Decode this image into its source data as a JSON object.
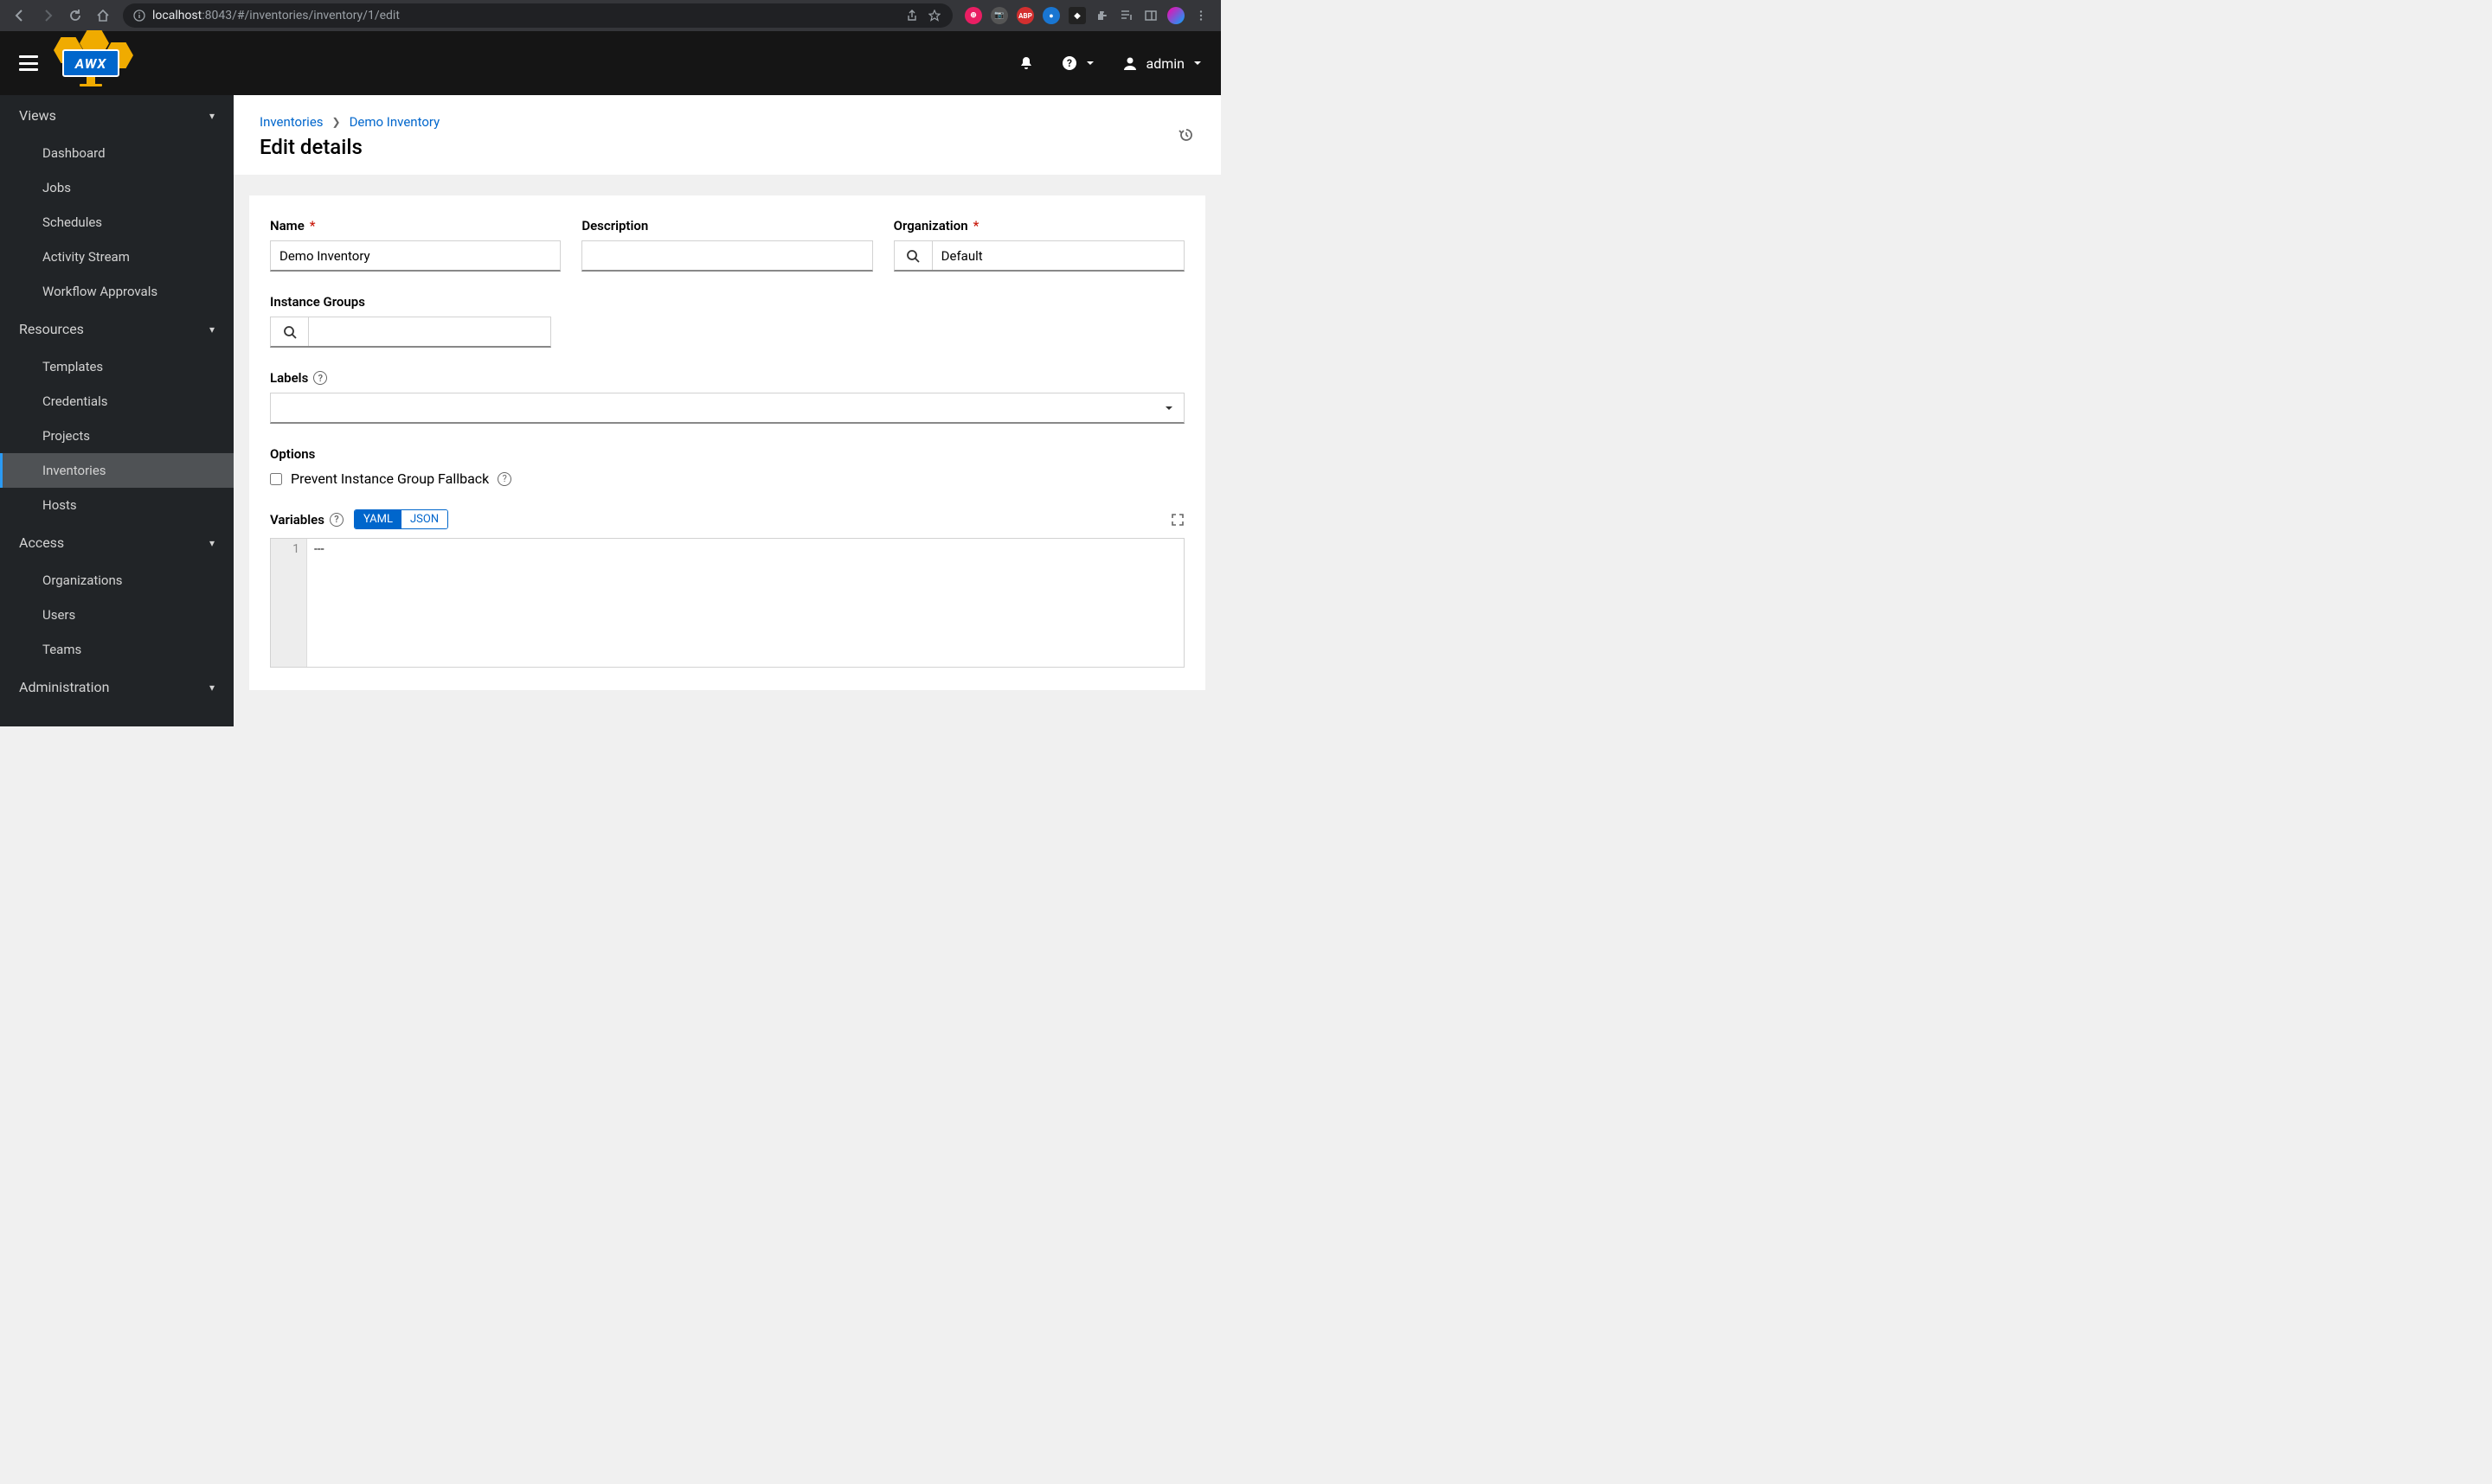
{
  "browser": {
    "url_host": "localhost",
    "url_port": ":8043",
    "url_path": "/#/inventories/inventory/1/edit"
  },
  "header": {
    "logo_text": "AWX",
    "username": "admin"
  },
  "sidebar": {
    "sections": {
      "views": {
        "label": "Views",
        "items": [
          "Dashboard",
          "Jobs",
          "Schedules",
          "Activity Stream",
          "Workflow Approvals"
        ]
      },
      "resources": {
        "label": "Resources",
        "items": [
          "Templates",
          "Credentials",
          "Projects",
          "Inventories",
          "Hosts"
        ]
      },
      "access": {
        "label": "Access",
        "items": [
          "Organizations",
          "Users",
          "Teams"
        ]
      },
      "administration": {
        "label": "Administration"
      }
    },
    "active": "Inventories"
  },
  "breadcrumb": {
    "root": "Inventories",
    "current": "Demo Inventory"
  },
  "page": {
    "title": "Edit details"
  },
  "form": {
    "name_label": "Name",
    "name_value": "Demo Inventory",
    "description_label": "Description",
    "description_value": "",
    "organization_label": "Organization",
    "organization_value": "Default",
    "instance_groups_label": "Instance Groups",
    "instance_groups_value": "",
    "labels_label": "Labels",
    "options_label": "Options",
    "prevent_fallback_label": "Prevent Instance Group Fallback",
    "variables_label": "Variables",
    "yaml_label": "YAML",
    "json_label": "JSON",
    "editor_line": "1",
    "editor_content": "---"
  }
}
